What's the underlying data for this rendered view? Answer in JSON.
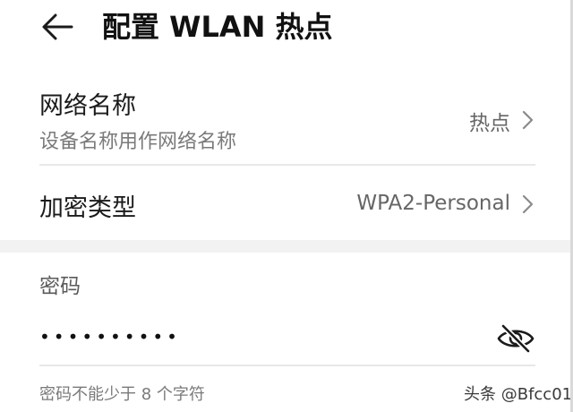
{
  "header": {
    "title": "配置 WLAN 热点",
    "back_icon": "arrow-left-icon"
  },
  "network_name": {
    "label": "网络名称",
    "subtitle": "设备名称用作网络名称",
    "value": "热点",
    "chevron_icon": "chevron-right-icon"
  },
  "encryption": {
    "label": "加密类型",
    "value": "WPA2-Personal",
    "chevron_icon": "chevron-right-icon"
  },
  "password": {
    "section_label": "密码",
    "masked_value": "••••••••••",
    "toggle_icon": "eye-off-icon",
    "hint": "密码不能少于 8 个字符"
  },
  "watermark": "头条 @Bfcc01",
  "colors": {
    "text_primary": "#1b1b1b",
    "text_secondary": "#7a7a7a",
    "divider": "#e8e8e8",
    "section_band": "#f2f2f2"
  }
}
